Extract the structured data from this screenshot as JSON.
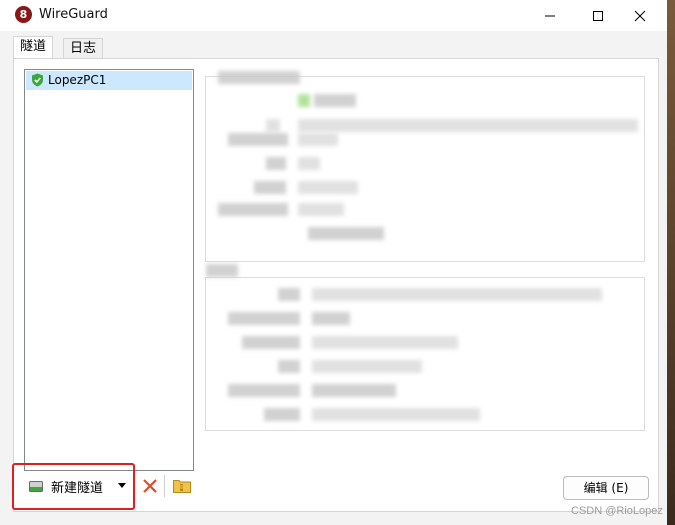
{
  "window": {
    "title": "WireGuard",
    "app_icon_glyph": "8"
  },
  "tabs": [
    {
      "label": "隧道",
      "active": true
    },
    {
      "label": "日志",
      "active": false
    }
  ],
  "tunnels": [
    {
      "name": "LopezPC1",
      "status_icon": "shield-check-icon",
      "status_color": "#3aa83a"
    }
  ],
  "toolbar": {
    "add_label": "新建隧道",
    "edit_label": "编辑 (E)"
  },
  "watermark": "CSDN @RioLopez",
  "colors": {
    "accent_selected": "#cce8ff",
    "highlight_outline": "#e02020",
    "delete_icon": "#e04a2a"
  }
}
